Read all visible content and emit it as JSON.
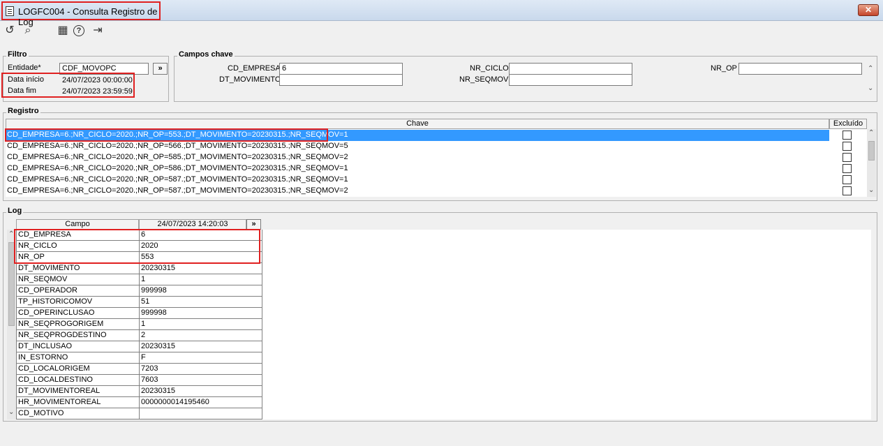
{
  "window": {
    "title": "LOGFC004 - Consulta Registro de Log",
    "close_label": "✕"
  },
  "toolbar": {
    "items": [
      {
        "name": "undo-icon",
        "glyph": "↺"
      },
      {
        "name": "search-icon",
        "glyph": "⌕"
      },
      {
        "name": "calendar-icon",
        "glyph": "▦"
      },
      {
        "name": "help-icon",
        "glyph": "?"
      },
      {
        "name": "exit-icon",
        "glyph": "⇥"
      }
    ]
  },
  "filtro": {
    "title": "Filtro",
    "entidade_label": "Entidade*",
    "entidade_value": "CDF_MOVOPC",
    "entidade_btn": "»",
    "data_inicio_label": "Data início",
    "data_inicio_value": "24/07/2023 00:00:00",
    "data_fim_label": "Data fim",
    "data_fim_value": "24/07/2023 23:59:59"
  },
  "campos_chave": {
    "title": "Campos chave",
    "cd_empresa_label": "CD_EMPRESA",
    "cd_empresa_value": "6",
    "dt_movimento_label": "DT_MOVIMENTO",
    "dt_movimento_value": "",
    "nr_ciclo_label": "NR_CICLO",
    "nr_ciclo_value": "",
    "nr_seqmov_label": "NR_SEQMOV",
    "nr_seqmov_value": "",
    "nr_op_label": "NR_OP",
    "nr_op_value": ""
  },
  "registro": {
    "title": "Registro",
    "col_chave": "Chave",
    "col_excluido": "Excluído",
    "rows": [
      {
        "chave": "CD_EMPRESA=6.;NR_CICLO=2020.;NR_OP=553.;DT_MOVIMENTO=20230315.;NR_SEQMOV=1",
        "excluido": false,
        "selected": true
      },
      {
        "chave": "CD_EMPRESA=6.;NR_CICLO=2020.;NR_OP=566.;DT_MOVIMENTO=20230315.;NR_SEQMOV=5",
        "excluido": false,
        "selected": false
      },
      {
        "chave": "CD_EMPRESA=6.;NR_CICLO=2020.;NR_OP=585.;DT_MOVIMENTO=20230315.;NR_SEQMOV=2",
        "excluido": false,
        "selected": false
      },
      {
        "chave": "CD_EMPRESA=6.;NR_CICLO=2020.;NR_OP=586.;DT_MOVIMENTO=20230315.;NR_SEQMOV=1",
        "excluido": false,
        "selected": false
      },
      {
        "chave": "CD_EMPRESA=6.;NR_CICLO=2020.;NR_OP=587.;DT_MOVIMENTO=20230315.;NR_SEQMOV=1",
        "excluido": false,
        "selected": false
      },
      {
        "chave": "CD_EMPRESA=6.;NR_CICLO=2020.;NR_OP=587.;DT_MOVIMENTO=20230315.;NR_SEQMOV=2",
        "excluido": false,
        "selected": false
      }
    ]
  },
  "log": {
    "title": "Log",
    "col_campo": "Campo",
    "col_timestamp": "24/07/2023 14:20:03",
    "col_more": "»",
    "rows": [
      {
        "campo": "CD_EMPRESA",
        "valor": "6"
      },
      {
        "campo": "NR_CICLO",
        "valor": "2020"
      },
      {
        "campo": "NR_OP",
        "valor": "553"
      },
      {
        "campo": "DT_MOVIMENTO",
        "valor": "20230315"
      },
      {
        "campo": "NR_SEQMOV",
        "valor": "1"
      },
      {
        "campo": "CD_OPERADOR",
        "valor": "999998"
      },
      {
        "campo": "TP_HISTORICOMOV",
        "valor": "51"
      },
      {
        "campo": "CD_OPERINCLUSAO",
        "valor": "999998"
      },
      {
        "campo": "NR_SEQPROGORIGEM",
        "valor": "1"
      },
      {
        "campo": "NR_SEQPROGDESTINO",
        "valor": "2"
      },
      {
        "campo": "DT_INCLUSAO",
        "valor": "20230315"
      },
      {
        "campo": "IN_ESTORNO",
        "valor": "F"
      },
      {
        "campo": "CD_LOCALORIGEM",
        "valor": "7203"
      },
      {
        "campo": "CD_LOCALDESTINO",
        "valor": "7603"
      },
      {
        "campo": "DT_MOVIMENTOREAL",
        "valor": "20230315"
      },
      {
        "campo": "HR_MOVIMENTOREAL",
        "valor": "0000000014195460"
      },
      {
        "campo": "CD_MOTIVO",
        "valor": ""
      }
    ]
  },
  "colors": {
    "selection": "#3399ff",
    "highlight_box": "#e02020"
  }
}
